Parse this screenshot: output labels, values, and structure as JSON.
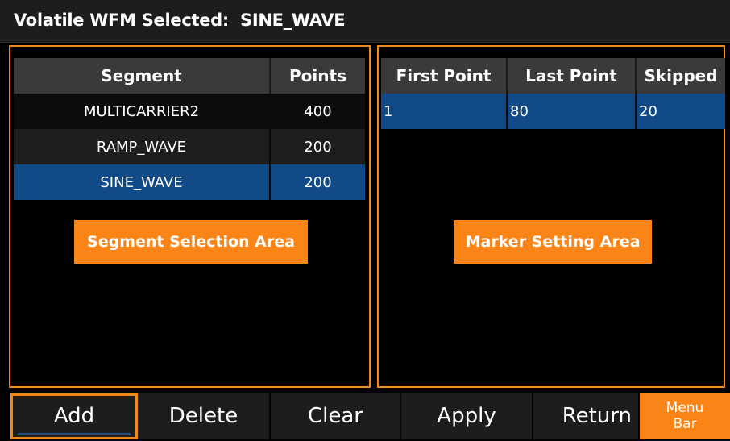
{
  "header": {
    "title": "Volatile WFM Selected:  SINE_WAVE"
  },
  "segment_panel": {
    "columns": [
      "Segment",
      "Points"
    ],
    "rows": [
      {
        "segment": "MULTICARRIER2",
        "points": "400"
      },
      {
        "segment": "RAMP_WAVE",
        "points": "200"
      },
      {
        "segment": "SINE_WAVE",
        "points": "200",
        "selected": true
      }
    ],
    "area_label": "Segment Selection Area"
  },
  "marker_panel": {
    "columns": [
      "First Point",
      "Last Point",
      "Skipped"
    ],
    "rows": [
      {
        "first": "1",
        "last": "80",
        "skipped": "20"
      }
    ],
    "area_label": "Marker Setting Area"
  },
  "menu": {
    "add": "Add",
    "delete": "Delete",
    "clear": "Clear",
    "apply": "Apply",
    "return": "Return",
    "menu_bar_line1": "Menu",
    "menu_bar_line2": "Bar"
  },
  "colors": {
    "accent_orange": "#fb8417",
    "selection_blue": "#114a86",
    "header_gray": "#3a3a3c"
  }
}
